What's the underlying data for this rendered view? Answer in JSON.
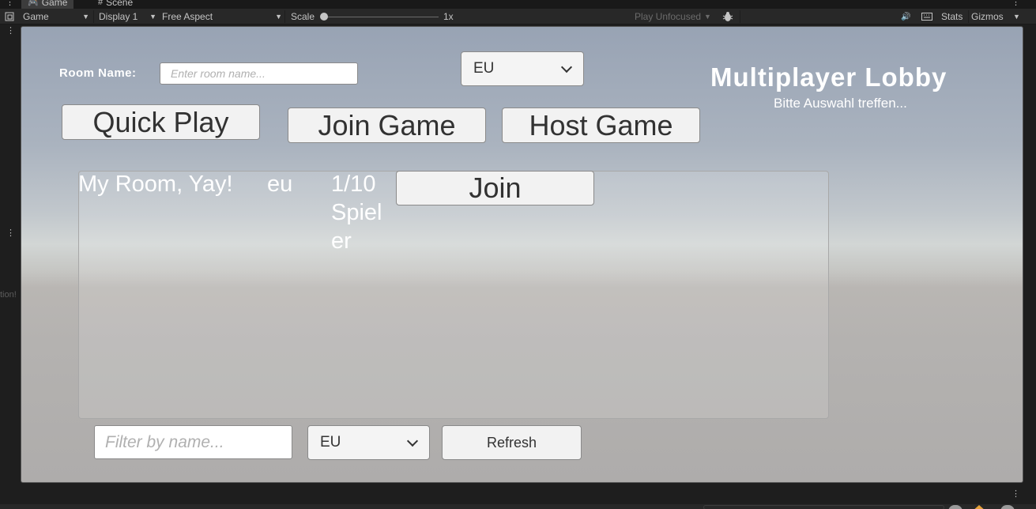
{
  "editor": {
    "tabs": [
      {
        "label": "Game",
        "icon": "gamepad-icon"
      },
      {
        "label": "Scene",
        "icon": "grid-icon"
      }
    ],
    "toolbar": {
      "view_mode": "Game",
      "display": "Display 1",
      "aspect": "Free Aspect",
      "scale_label": "Scale",
      "scale_value": "1x",
      "play_mode": "Play Unfocused",
      "stats_label": "Stats",
      "gizmos_label": "Gizmos"
    },
    "left_panel_text": "tion!"
  },
  "lobby": {
    "room_name_label": "Room Name:",
    "room_name_placeholder": "Enter room name...",
    "region_top": "EU",
    "title": "Multiplayer Lobby",
    "subtitle": "Bitte Auswahl treffen...",
    "buttons": {
      "quick_play": "Quick Play",
      "join_game": "Join Game",
      "host_game": "Host Game"
    },
    "rooms": [
      {
        "name": "My Room, Yay!",
        "region": "eu",
        "players": "1/10 Spieler",
        "join_label": "Join"
      }
    ],
    "filter_placeholder": "Filter by name...",
    "region_bottom": "EU",
    "refresh_label": "Refresh"
  }
}
